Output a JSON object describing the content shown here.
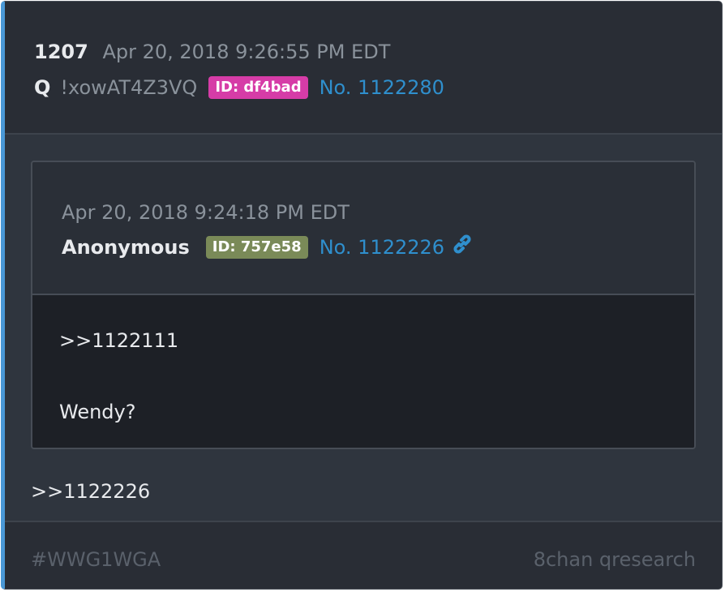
{
  "colors": {
    "accent_border": "#4a98d6",
    "post_id_badge": "#d63ca7",
    "quote_id_badge": "#7a8a58",
    "link": "#2f8fcd"
  },
  "post": {
    "number": "1207",
    "date": "Apr 20, 2018 9:26:55 PM EDT",
    "name": "Q",
    "tripcode": "!xowAT4Z3VQ",
    "id_badge": "ID: df4bad",
    "post_link": "No. 1122280"
  },
  "quoted": {
    "date": "Apr 20, 2018 9:24:18 PM EDT",
    "name": "Anonymous",
    "id_badge": "ID: 757e58",
    "post_link": "No. 1122226",
    "link_icon": "link-icon",
    "body_lines": [
      ">>1122111",
      "Wendy?"
    ]
  },
  "reply_text": ">>1122226",
  "footer": {
    "hashtag": "#WWG1WGA",
    "source": "8chan qresearch"
  }
}
